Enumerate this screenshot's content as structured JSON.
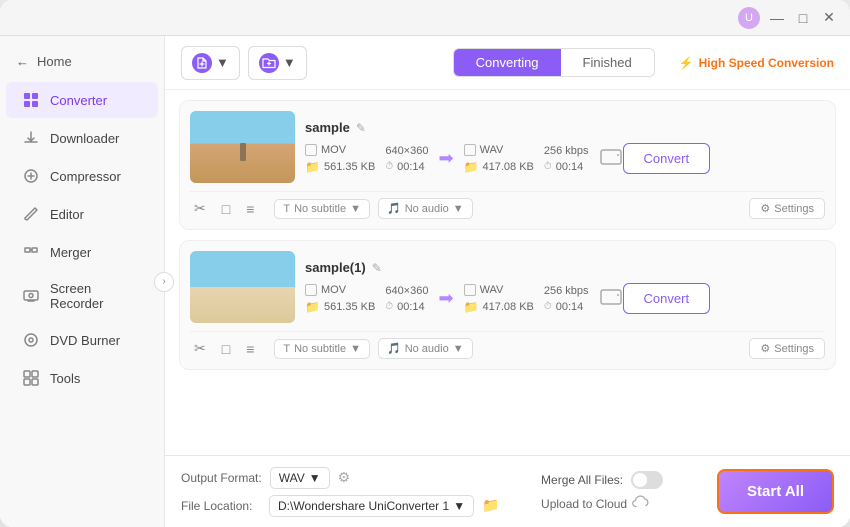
{
  "titlebar": {
    "icon_label": "U",
    "btn_minimize": "—",
    "btn_maximize": "□",
    "btn_close": "✕"
  },
  "sidebar": {
    "home_label": "Home",
    "items": [
      {
        "id": "converter",
        "label": "Converter",
        "active": true
      },
      {
        "id": "downloader",
        "label": "Downloader",
        "active": false
      },
      {
        "id": "compressor",
        "label": "Compressor",
        "active": false
      },
      {
        "id": "editor",
        "label": "Editor",
        "active": false
      },
      {
        "id": "merger",
        "label": "Merger",
        "active": false
      },
      {
        "id": "screen-recorder",
        "label": "Screen Recorder",
        "active": false
      },
      {
        "id": "dvd-burner",
        "label": "DVD Burner",
        "active": false
      },
      {
        "id": "tools",
        "label": "Tools",
        "active": false
      }
    ]
  },
  "toolbar": {
    "add_files_label": "Add Files",
    "add_files_dropdown": "▾",
    "add_folder_label": "Add Folder",
    "tab_converting": "Converting",
    "tab_finished": "Finished",
    "speed_label": "High Speed Conversion"
  },
  "files": [
    {
      "id": "file1",
      "name": "sample",
      "format_in": "MOV",
      "resolution": "640×360",
      "size_in": "561.35 KB",
      "duration_in": "00:14",
      "format_out": "WAV",
      "bitrate_out": "256 kbps",
      "size_out": "417.08 KB",
      "duration_out": "00:14",
      "subtitle": "No subtitle",
      "audio": "No audio",
      "convert_label": "Convert",
      "settings_label": "Settings"
    },
    {
      "id": "file2",
      "name": "sample(1)",
      "format_in": "MOV",
      "resolution": "640×360",
      "size_in": "561.35 KB",
      "duration_in": "00:14",
      "format_out": "WAV",
      "bitrate_out": "256 kbps",
      "size_out": "417.08 KB",
      "duration_out": "00:14",
      "subtitle": "No subtitle",
      "audio": "No audio",
      "convert_label": "Convert",
      "settings_label": "Settings"
    }
  ],
  "bottom": {
    "output_format_label": "Output Format:",
    "output_format_value": "WAV",
    "file_location_label": "File Location:",
    "file_location_value": "D:\\Wondershare UniConverter 1",
    "merge_files_label": "Merge All Files:",
    "upload_cloud_label": "Upload to Cloud",
    "start_all_label": "Start All"
  }
}
